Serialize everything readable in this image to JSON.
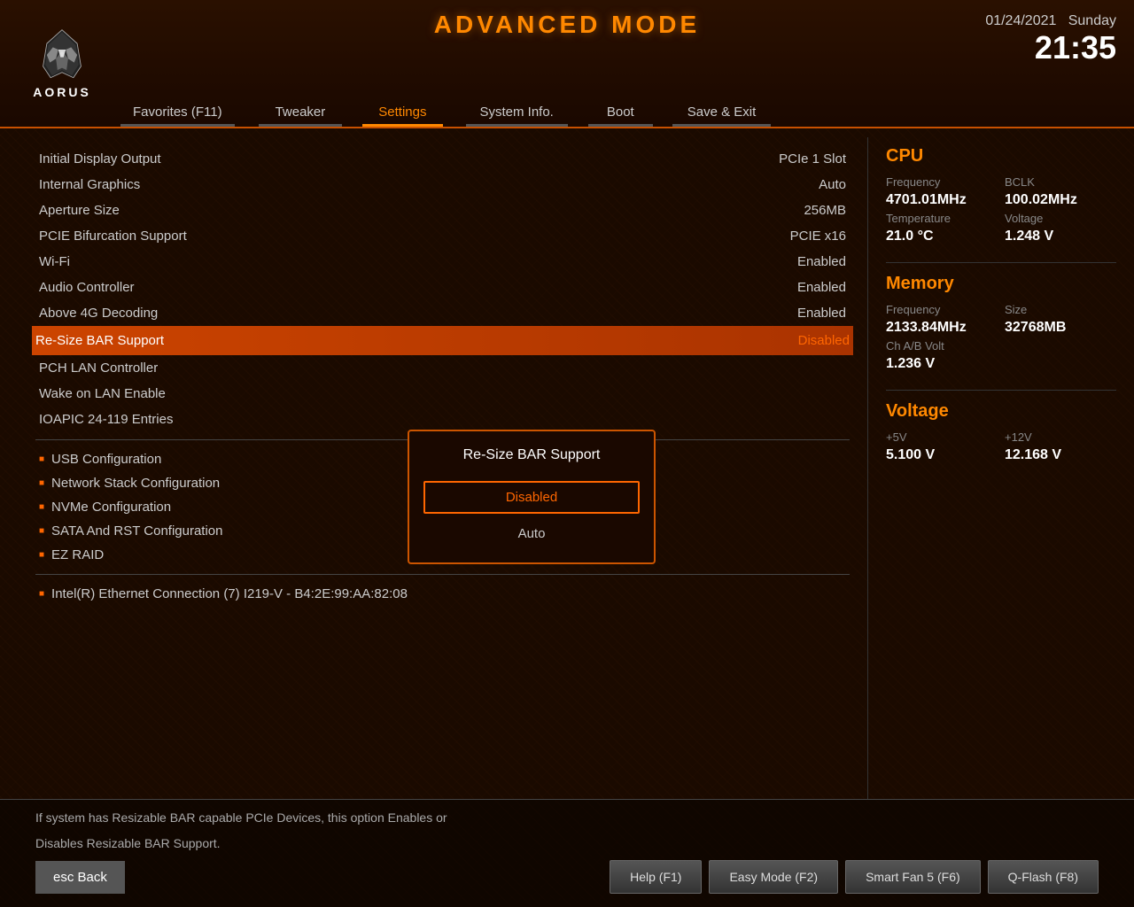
{
  "header": {
    "title": "ADVANCED MODE",
    "logo_text": "AORUS",
    "date": "01/24/2021",
    "day": "Sunday",
    "time": "21:35"
  },
  "nav": {
    "tabs": [
      {
        "label": "Favorites (F11)",
        "active": false
      },
      {
        "label": "Tweaker",
        "active": false
      },
      {
        "label": "Settings",
        "active": true
      },
      {
        "label": "System Info.",
        "active": false
      },
      {
        "label": "Boot",
        "active": false
      },
      {
        "label": "Save & Exit",
        "active": false
      }
    ]
  },
  "settings": {
    "rows": [
      {
        "name": "Initial Display Output",
        "value": "PCIe 1 Slot",
        "highlighted": false
      },
      {
        "name": "Internal Graphics",
        "value": "Auto",
        "highlighted": false
      },
      {
        "name": "Aperture Size",
        "value": "256MB",
        "highlighted": false
      },
      {
        "name": "PCIE Bifurcation Support",
        "value": "PCIE x16",
        "highlighted": false
      },
      {
        "name": "Wi-Fi",
        "value": "Enabled",
        "highlighted": false
      },
      {
        "name": "Audio Controller",
        "value": "Enabled",
        "highlighted": false
      },
      {
        "name": "Above 4G Decoding",
        "value": "Enabled",
        "highlighted": false
      },
      {
        "name": "Re-Size BAR Support",
        "value": "Disabled",
        "highlighted": true
      },
      {
        "name": "PCH LAN Controller",
        "value": "",
        "highlighted": false
      },
      {
        "name": "Wake on LAN Enable",
        "value": "",
        "highlighted": false
      },
      {
        "name": "IOAPIC 24-119 Entries",
        "value": "",
        "highlighted": false
      }
    ],
    "submenus": [
      "USB Configuration",
      "Network Stack Configuration",
      "NVMe Configuration",
      "SATA And RST Configuration",
      "EZ RAID"
    ],
    "wide_submenu": "Intel(R) Ethernet Connection (7) I219-V - B4:2E:99:AA:82:08"
  },
  "dropdown": {
    "title": "Re-Size BAR Support",
    "options": [
      {
        "label": "Disabled",
        "selected": true
      },
      {
        "label": "Auto",
        "selected": false
      }
    ]
  },
  "cpu": {
    "section_title": "CPU",
    "freq_label": "Frequency",
    "bclk_label": "BCLK",
    "freq_value": "4701.01MHz",
    "bclk_value": "100.02MHz",
    "temp_label": "Temperature",
    "volt_label": "Voltage",
    "temp_value": "21.0 °C",
    "volt_value": "1.248 V"
  },
  "memory": {
    "section_title": "Memory",
    "freq_label": "Frequency",
    "size_label": "Size",
    "freq_value": "2133.84MHz",
    "size_value": "32768MB",
    "chvolt_label": "Ch A/B Volt",
    "chvolt_value": "1.236 V"
  },
  "voltage": {
    "section_title": "Voltage",
    "v5_label": "+5V",
    "v12_label": "+12V",
    "v5_value": "5.100 V",
    "v12_value": "12.168 V"
  },
  "footer": {
    "help_text_1": "If system has Resizable BAR capable PCIe Devices, this option Enables or",
    "help_text_2": "Disables Resizable BAR Support.",
    "esc_label": "esc  Back",
    "buttons": [
      {
        "label": "Help (F1)"
      },
      {
        "label": "Easy Mode (F2)"
      },
      {
        "label": "Smart Fan 5 (F6)"
      },
      {
        "label": "Q-Flash (F8)"
      }
    ]
  }
}
